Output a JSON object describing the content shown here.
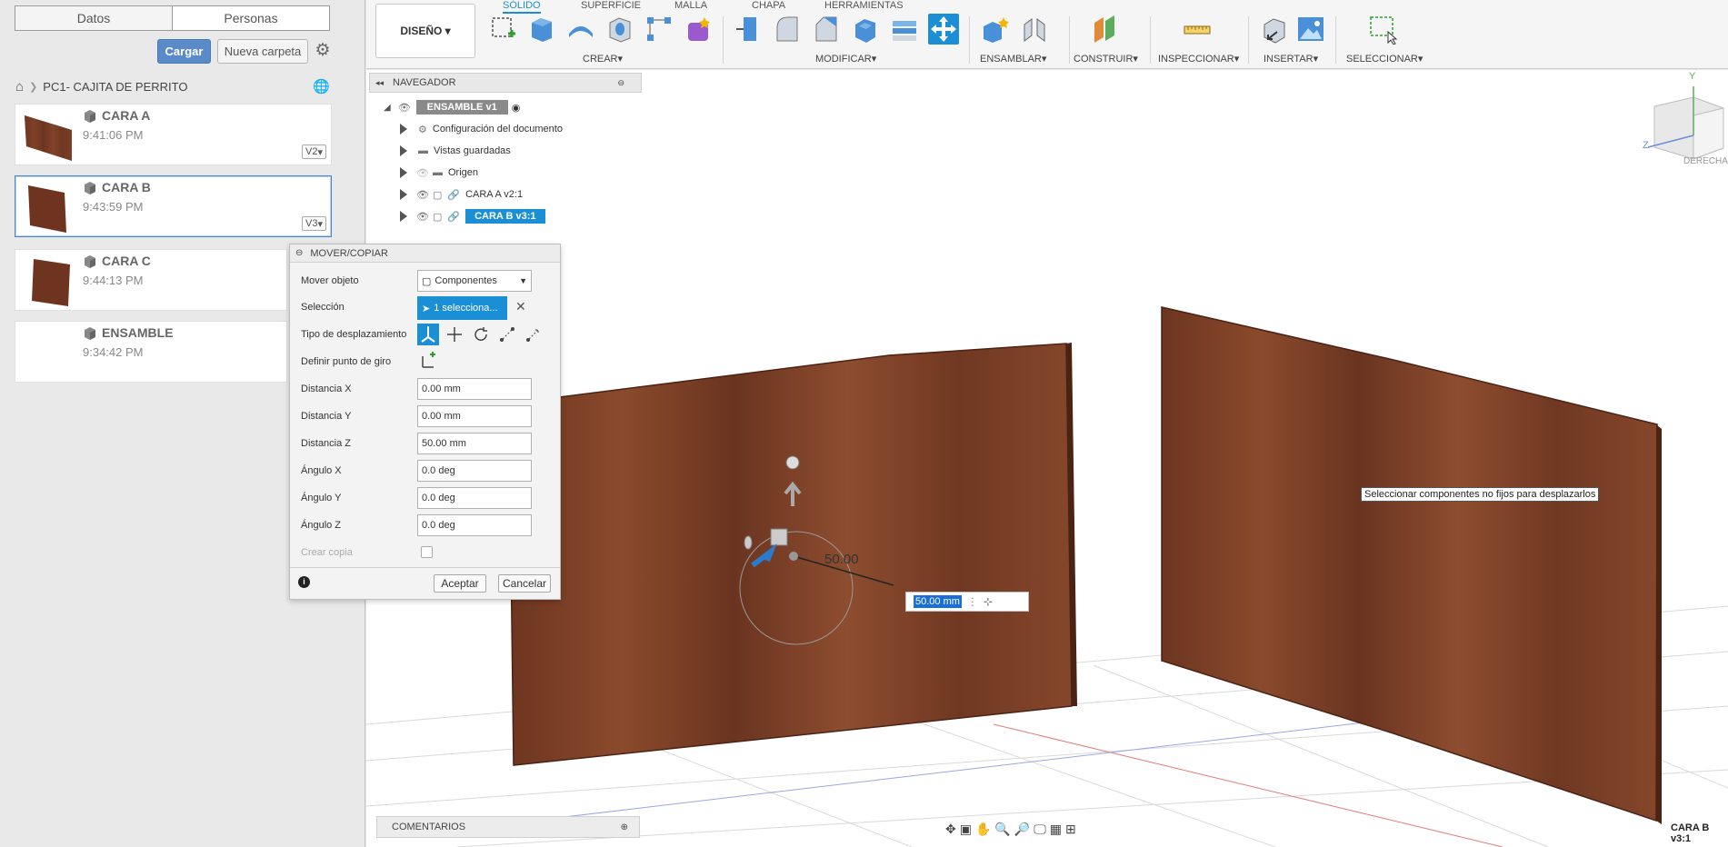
{
  "left_panel": {
    "tabs": [
      "Datos",
      "Personas"
    ],
    "upload_label": "Cargar",
    "new_folder_label": "Nueva carpeta",
    "breadcrumb": "PC1- CAJITA DE PERRITO",
    "files": [
      {
        "name": "CARA A",
        "time": "9:41:06 PM",
        "version": "V2",
        "selected": false
      },
      {
        "name": "CARA B",
        "time": "9:43:59 PM",
        "version": "V3",
        "selected": true
      },
      {
        "name": "CARA C",
        "time": "9:44:13 PM",
        "version": "",
        "selected": false
      },
      {
        "name": "ENSAMBLE",
        "time": "9:34:42 PM",
        "version": "",
        "selected": false
      }
    ]
  },
  "toolbar": {
    "workspace": "DISEÑO",
    "tabs": [
      "SÓLIDO",
      "SUPERFICIE",
      "MALLA",
      "CHAPA",
      "HERRAMIENTAS"
    ],
    "groups": {
      "crear": "CREAR",
      "modificar": "MODIFICAR",
      "ensamblar": "ENSAMBLAR",
      "construir": "CONSTRUIR",
      "inspeccionar": "INSPECCIONAR",
      "insertar": "INSERTAR",
      "seleccionar": "SELECCIONAR"
    }
  },
  "navigator": {
    "title": "NAVEGADOR",
    "root": "ENSAMBLE v1",
    "items": [
      "Configuración del documento",
      "Vistas guardadas",
      "Origen",
      "CARA A v2:1",
      "CARA B v3:1"
    ]
  },
  "dialog": {
    "title": "MOVER/COPIAR",
    "labels": {
      "move_object": "Mover objeto",
      "selection": "Selección",
      "move_type": "Tipo de desplazamiento",
      "pivot": "Definir punto de giro",
      "dist_x": "Distancia X",
      "dist_y": "Distancia Y",
      "dist_z": "Distancia Z",
      "angle_x": "Ángulo X",
      "angle_y": "Ángulo Y",
      "angle_z": "Ángulo Z",
      "create_copy": "Crear copia"
    },
    "values": {
      "move_object": "Componentes",
      "selection": "1 selecciona...",
      "dist_x": "0.00 mm",
      "dist_y": "0.00 mm",
      "dist_z": "50.00 mm",
      "angle_x": "0.0 deg",
      "angle_y": "0.0 deg",
      "angle_z": "0.0 deg"
    },
    "ok_label": "Aceptar",
    "cancel_label": "Cancelar"
  },
  "viewport": {
    "tooltip": "Seleccionar componentes no fijos para desplazarlos",
    "dim_label": "50.00",
    "dim_input": "50.00 mm",
    "viewcube_face": "DERECHA",
    "axis_y": "Y",
    "axis_z": "Z",
    "comments": "COMENTARIOS",
    "active_component": "CARA B v3:1"
  },
  "colors": {
    "accent": "#1a8fd6",
    "wood": "#7a3f25"
  }
}
